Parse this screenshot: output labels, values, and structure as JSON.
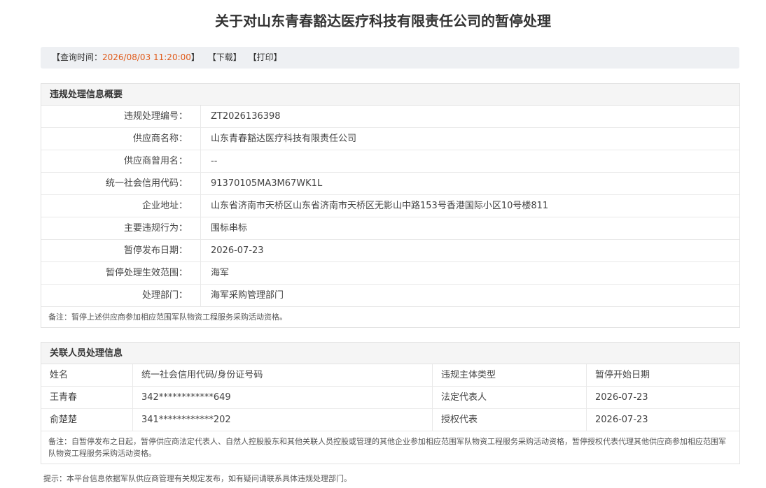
{
  "title": "关于对山东青春豁达医疗科技有限责任公司的暂停处理",
  "query_bar": {
    "time_prefix": "【查询时间：",
    "time_value": "2026/08/03 11:20:00",
    "time_suffix": "】",
    "download_label": "【下载】",
    "print_label": "【打印】"
  },
  "summary": {
    "heading": "违规处理信息概要",
    "rows": [
      {
        "key": "违规处理编号：",
        "value": "ZT2026136398"
      },
      {
        "key": "供应商名称：",
        "value": "山东青春豁达医疗科技有限责任公司"
      },
      {
        "key": "供应商曾用名：",
        "value": "--"
      },
      {
        "key": "统一社会信用代码：",
        "value": "91370105MA3M67WK1L"
      },
      {
        "key": "企业地址：",
        "value": "山东省济南市天桥区山东省济南市天桥区无影山中路153号香港国际小区10号楼811"
      },
      {
        "key": "主要违规行为：",
        "value": "围标串标"
      },
      {
        "key": "暂停发布日期：",
        "value": "2026-07-23"
      },
      {
        "key": "暂停处理生效范围：",
        "value": "海军"
      },
      {
        "key": "处理部门：",
        "value": "海军采购管理部门"
      }
    ],
    "note": "备注：暂停上述供应商参加相应范围军队物资工程服务采购活动资格。"
  },
  "related": {
    "heading": "关联人员处理信息",
    "columns": [
      "姓名",
      "统一社会信用代码/身份证号码",
      "违规主体类型",
      "暂停开始日期"
    ],
    "rows": [
      [
        "王青春",
        "342************649",
        "法定代表人",
        "2026-07-23"
      ],
      [
        "俞楚楚",
        "341************202",
        "授权代表",
        "2026-07-23"
      ]
    ],
    "note": "备注：自暂停发布之日起，暂停供应商法定代表人、自然人控股股东和其他关联人员控股或管理的其他企业参加相应范围军队物资工程服务采购活动资格，暂停授权代表代理其他供应商参加相应范围军队物资工程服务采购活动资格。"
  },
  "tip": "提示：本平台信息依据军队供应商管理有关规定发布，如有疑问请联系具体违规处理部门。"
}
